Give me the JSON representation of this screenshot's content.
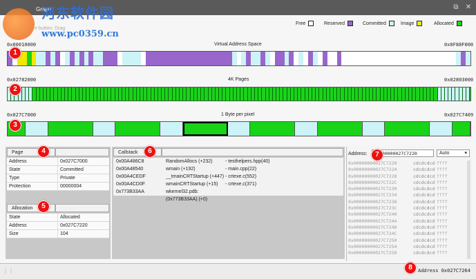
{
  "window": {
    "title": "Graph",
    "watermark_text": "河东软件园",
    "watermark_url": "www.pc0359.cn",
    "hint": "e button: Drag"
  },
  "legend": [
    {
      "label": "Free",
      "swatch": "free"
    },
    {
      "label": "Reserved",
      "swatch": "reserved"
    },
    {
      "label": "Committed",
      "swatch": "committed"
    },
    {
      "label": "Image",
      "swatch": "image"
    },
    {
      "label": "Allocated",
      "swatch": "allocated"
    }
  ],
  "colors": {
    "reserved": "#9966cc",
    "committed": "#ccf3f7",
    "image": "#f0e800",
    "allocated": "#19d319",
    "free": "#ffffff",
    "badge": "#e11111"
  },
  "vas": {
    "left": "0x00010000",
    "title": "Virtual Address Space",
    "right": "0x0F88F000"
  },
  "pages": {
    "left": "0x02782000",
    "title": "4K Pages",
    "right": "0x02803000"
  },
  "bytes": {
    "left": "0x027C7000",
    "title": "1 Byte per pixel",
    "right": "0x027C7409"
  },
  "badges": [
    "1",
    "2",
    "3",
    "4",
    "5",
    "6",
    "7",
    "8"
  ],
  "page_panel": {
    "header": "Page",
    "rows": [
      {
        "k": "Address",
        "v": "0x027C7000"
      },
      {
        "k": "State",
        "v": "Committed"
      },
      {
        "k": "Type",
        "v": "Private"
      },
      {
        "k": "Protection",
        "v": "00000004"
      }
    ]
  },
  "alloc_panel": {
    "header": "Allocation",
    "rows": [
      {
        "k": "State",
        "v": "Allocated"
      },
      {
        "k": "Address",
        "v": "0x027C7220"
      },
      {
        "k": "Size",
        "v": "104"
      }
    ]
  },
  "callstack": {
    "header": "Callstack",
    "rows": [
      {
        "addr": "0x00A486C8",
        "fn": "RandomAllocs  (+232)",
        "src": "- testhelpers.hpp(40)"
      },
      {
        "addr": "0x00A48540",
        "fn": "wmain  (+192)",
        "src": "- main.cpp(22)"
      },
      {
        "addr": "0x00A4CEDF",
        "fn": "__tmainCRTStartup  (+447)",
        "src": "- crtexe.c(552)"
      },
      {
        "addr": "0x00A4CD0F",
        "fn": "wmainCRTStartup  (+15)",
        "src": "- crtexe.c(371)"
      },
      {
        "addr": "0x773B33AA",
        "fn": "wkernel32.pdb: (0x773B33AA) (+0)",
        "src": ""
      }
    ]
  },
  "hexview": {
    "address_label": "Address:",
    "address_value": "000000027C7220",
    "mode": "Auto",
    "rows": [
      {
        "a": "0x00000000027C7220",
        "b": "cdcdcdcd",
        "c": "ffff"
      },
      {
        "a": "0x00000000027C7224",
        "b": "cdcdcdcd",
        "c": "ffff"
      },
      {
        "a": "0x00000000027C7228",
        "b": "cdcdcdcd",
        "c": "ffff"
      },
      {
        "a": "0x00000000027C722C",
        "b": "cdcdcdcd",
        "c": "ffff"
      },
      {
        "a": "0x00000000027C7230",
        "b": "cdcdcdcd",
        "c": "ffff"
      },
      {
        "a": "0x00000000027C7234",
        "b": "cdcdcdcd",
        "c": "ffff"
      },
      {
        "a": "0x00000000027C7238",
        "b": "cdcdcdcd",
        "c": "ffff"
      },
      {
        "a": "0x00000000027C723C",
        "b": "cdcdcdcd",
        "c": "ffff"
      },
      {
        "a": "0x00000000027C7240",
        "b": "cdcdcdcd",
        "c": "ffff"
      },
      {
        "a": "0x00000000027C7244",
        "b": "cdcdcdcd",
        "c": "ffff"
      },
      {
        "a": "0x00000000027C7248",
        "b": "cdcdcdcd",
        "c": "ffff"
      },
      {
        "a": "0x00000000027C724C",
        "b": "cdcdcdcd",
        "c": "ffff"
      },
      {
        "a": "0x00000000027C7250",
        "b": "cdcdcdcd",
        "c": "ffff"
      },
      {
        "a": "0x00000000027C7254",
        "b": "cdcdcdcd",
        "c": "ffff"
      },
      {
        "a": "0x00000000027C7258",
        "b": "cdcdcdcd",
        "c": "ffff"
      }
    ]
  },
  "status": {
    "text": "Address 0x027C7264"
  }
}
